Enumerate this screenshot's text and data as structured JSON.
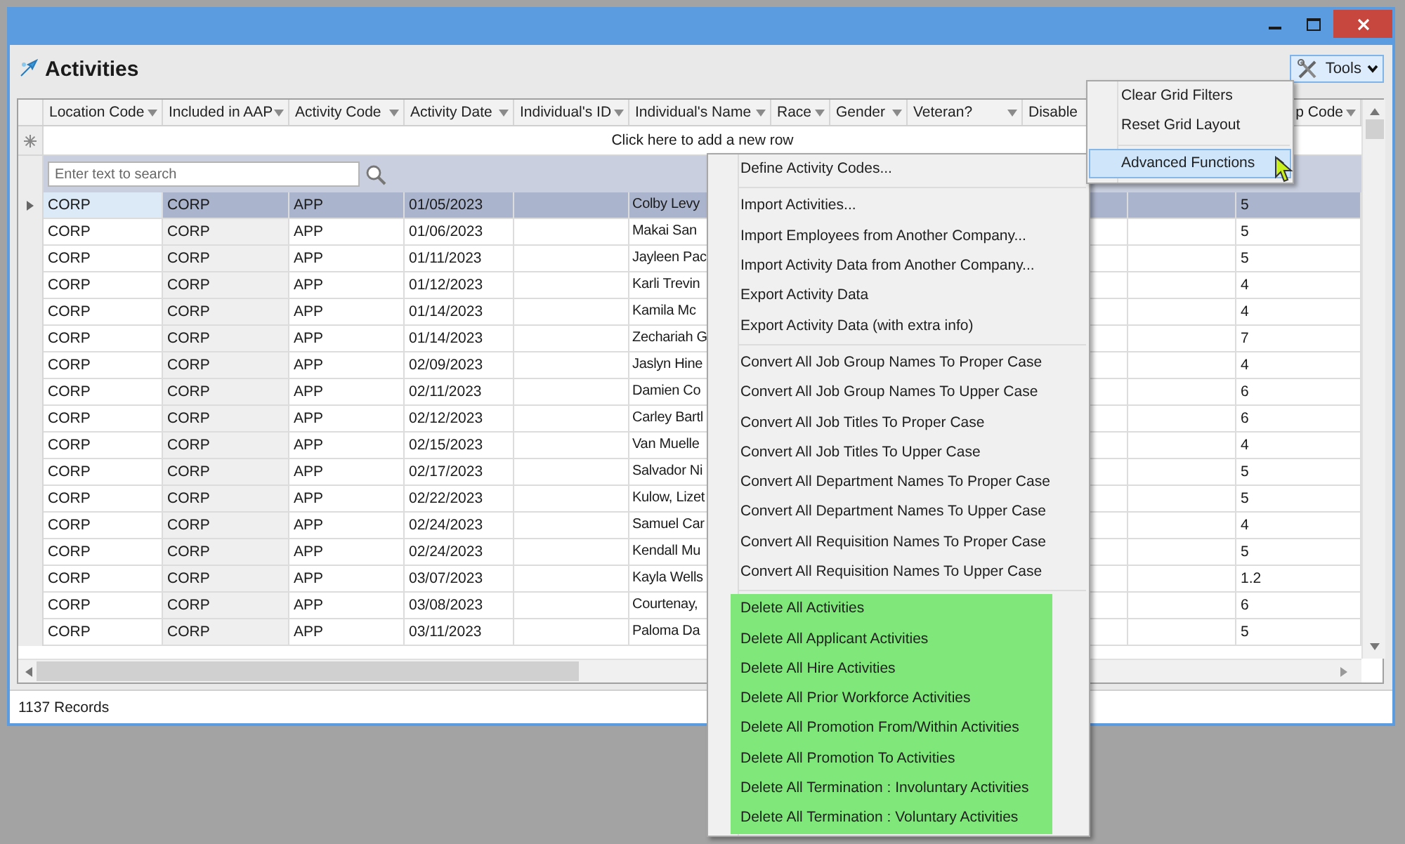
{
  "page": {
    "title": "Activities"
  },
  "tools_button": {
    "label": "Tools"
  },
  "grid": {
    "columns": [
      {
        "label": "Location Code",
        "filter": true
      },
      {
        "label": "Included in AAP",
        "filter": true
      },
      {
        "label": "Activity Code",
        "filter": true
      },
      {
        "label": "Activity Date",
        "filter": true
      },
      {
        "label": "Individual's ID",
        "filter": true
      },
      {
        "label": "Individual's Name",
        "filter": true
      },
      {
        "label": "Race",
        "filter": true
      },
      {
        "label": "Gender",
        "filter": true
      },
      {
        "label": "Veteran?",
        "filter": true
      },
      {
        "label": "Disable",
        "filter": false
      },
      {
        "label": "p Code",
        "filter": true
      }
    ],
    "new_row_prompt": "Click here to add a new row",
    "search": {
      "placeholder": "Enter text to search"
    },
    "rows": [
      {
        "selected": true,
        "cells": [
          "CORP",
          "CORP",
          "APP",
          "01/05/2023",
          "",
          "Colby Levy",
          "",
          "",
          "",
          "",
          "5"
        ]
      },
      {
        "selected": false,
        "cells": [
          "CORP",
          "CORP",
          "APP",
          "01/06/2023",
          "",
          "Makai San",
          "",
          "",
          "",
          "",
          "5"
        ]
      },
      {
        "selected": false,
        "cells": [
          "CORP",
          "CORP",
          "APP",
          "01/11/2023",
          "",
          "Jayleen Pac",
          "",
          "",
          "",
          "",
          "5"
        ]
      },
      {
        "selected": false,
        "cells": [
          "CORP",
          "CORP",
          "APP",
          "01/12/2023",
          "",
          "Karli Trevin",
          "",
          "",
          "",
          "",
          "4"
        ]
      },
      {
        "selected": false,
        "cells": [
          "CORP",
          "CORP",
          "APP",
          "01/14/2023",
          "",
          "Kamila Mc",
          "",
          "",
          "",
          "",
          "4"
        ]
      },
      {
        "selected": false,
        "cells": [
          "CORP",
          "CORP",
          "APP",
          "01/14/2023",
          "",
          "Zechariah G",
          "",
          "",
          "",
          "",
          "7"
        ]
      },
      {
        "selected": false,
        "cells": [
          "CORP",
          "CORP",
          "APP",
          "02/09/2023",
          "",
          "Jaslyn Hine",
          "",
          "",
          "",
          "",
          "4"
        ]
      },
      {
        "selected": false,
        "cells": [
          "CORP",
          "CORP",
          "APP",
          "02/11/2023",
          "",
          "Damien Co",
          "",
          "",
          "",
          "",
          "6"
        ]
      },
      {
        "selected": false,
        "cells": [
          "CORP",
          "CORP",
          "APP",
          "02/12/2023",
          "",
          "Carley Bartl",
          "",
          "",
          "",
          "",
          "6"
        ]
      },
      {
        "selected": false,
        "cells": [
          "CORP",
          "CORP",
          "APP",
          "02/15/2023",
          "",
          "Van Muelle",
          "",
          "",
          "",
          "",
          "4"
        ]
      },
      {
        "selected": false,
        "cells": [
          "CORP",
          "CORP",
          "APP",
          "02/17/2023",
          "",
          "Salvador Ni",
          "",
          "",
          "",
          "",
          "5"
        ]
      },
      {
        "selected": false,
        "cells": [
          "CORP",
          "CORP",
          "APP",
          "02/22/2023",
          "",
          "Kulow, Lizet",
          "",
          "",
          "",
          "",
          "5"
        ]
      },
      {
        "selected": false,
        "cells": [
          "CORP",
          "CORP",
          "APP",
          "02/24/2023",
          "",
          "Samuel Car",
          "",
          "",
          "",
          "",
          "4"
        ]
      },
      {
        "selected": false,
        "cells": [
          "CORP",
          "CORP",
          "APP",
          "02/24/2023",
          "",
          "Kendall Mu",
          "",
          "",
          "",
          "",
          "5"
        ]
      },
      {
        "selected": false,
        "cells": [
          "CORP",
          "CORP",
          "APP",
          "03/07/2023",
          "",
          "Kayla Wells",
          "",
          "",
          "",
          "",
          "1.2"
        ]
      },
      {
        "selected": false,
        "cells": [
          "CORP",
          "CORP",
          "APP",
          "03/08/2023",
          "",
          "Courtenay,",
          "",
          "",
          "",
          "",
          "6"
        ]
      },
      {
        "selected": false,
        "cells": [
          "CORP",
          "CORP",
          "APP",
          "03/11/2023",
          "",
          "Paloma Da",
          "",
          "",
          "",
          "",
          "5"
        ]
      }
    ]
  },
  "status_bar": {
    "text": "1137 Records"
  },
  "tools_menu": {
    "items": [
      {
        "kind": "item",
        "label": "Clear Grid Filters",
        "selected": false,
        "submenu": false
      },
      {
        "kind": "item",
        "label": "Reset Grid Layout",
        "selected": false,
        "submenu": false
      },
      {
        "kind": "separator"
      },
      {
        "kind": "item",
        "label": "Advanced Functions",
        "selected": true,
        "submenu": true
      }
    ]
  },
  "context_menu": {
    "items": [
      {
        "kind": "item",
        "label": "Define Activity Codes...",
        "selected": false
      },
      {
        "kind": "separator"
      },
      {
        "kind": "item",
        "label": "Import Activities...",
        "selected": false
      },
      {
        "kind": "item",
        "label": "Import Employees from Another Company...",
        "selected": false
      },
      {
        "kind": "item",
        "label": "Import Activity Data from Another Company...",
        "selected": false
      },
      {
        "kind": "item",
        "label": "Export Activity Data",
        "selected": false
      },
      {
        "kind": "item",
        "label": "Export Activity Data (with extra info)",
        "selected": false
      },
      {
        "kind": "separator"
      },
      {
        "kind": "item",
        "label": "Convert All Job Group Names To Proper Case",
        "selected": false
      },
      {
        "kind": "item",
        "label": "Convert All Job Group Names To Upper Case",
        "selected": false
      },
      {
        "kind": "item",
        "label": "Convert All Job Titles To Proper Case",
        "selected": false
      },
      {
        "kind": "item",
        "label": "Convert All Job Titles To Upper Case",
        "selected": false
      },
      {
        "kind": "item",
        "label": "Convert All Department Names To Proper Case",
        "selected": false
      },
      {
        "kind": "item",
        "label": "Convert All Department Names To Upper Case",
        "selected": false
      },
      {
        "kind": "item",
        "label": "Convert All Requisition Names To Proper Case",
        "selected": false
      },
      {
        "kind": "item",
        "label": "Convert All Requisition Names To Upper Case",
        "selected": false
      },
      {
        "kind": "separator"
      },
      {
        "kind": "item",
        "label": "Delete All Activities",
        "selected": false,
        "color": "#80e87a"
      },
      {
        "kind": "item",
        "label": "Delete All Applicant Activities",
        "selected": false,
        "color": "#80e87a"
      },
      {
        "kind": "item",
        "label": "Delete All Hire Activities",
        "selected": false,
        "color": "#80e87a"
      },
      {
        "kind": "item",
        "label": "Delete All Prior Workforce Activities",
        "selected": false,
        "color": "#80e87a"
      },
      {
        "kind": "item",
        "label": "Delete All Promotion From/Within Activities",
        "selected": false,
        "color": "#80e87a"
      },
      {
        "kind": "item",
        "label": "Delete All Promotion To Activities",
        "selected": false,
        "color": "#80e87a"
      },
      {
        "kind": "item",
        "label": "Delete All Termination : Involuntary Activities",
        "selected": false,
        "color": "#80e87a"
      },
      {
        "kind": "item",
        "label": "Delete All Termination : Voluntary Activities",
        "selected": false,
        "color": "#80e87a"
      }
    ]
  }
}
